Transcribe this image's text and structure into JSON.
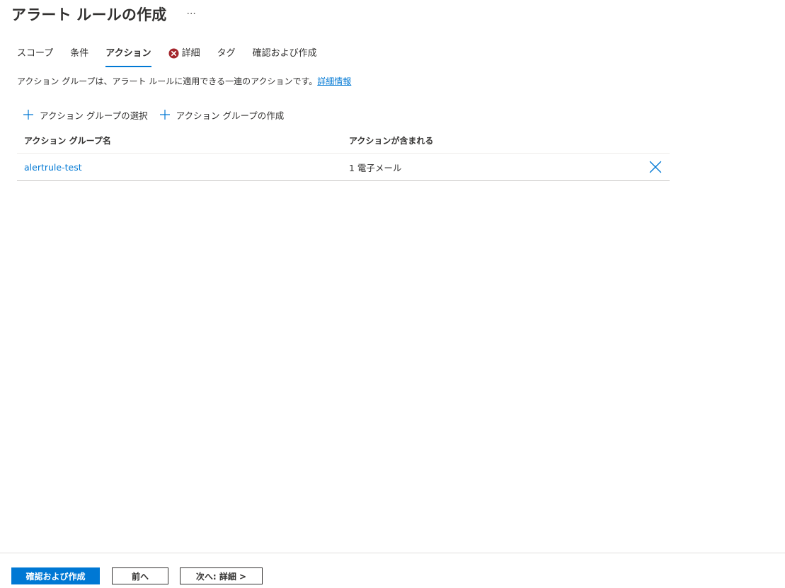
{
  "header": {
    "title": "アラート ルールの作成",
    "more_label": "···"
  },
  "tabs": [
    {
      "label": "スコープ",
      "active": false
    },
    {
      "label": "条件",
      "active": false
    },
    {
      "label": "アクション",
      "active": true
    },
    {
      "label": "詳細",
      "active": false,
      "has_error": true,
      "icon": "error-circle-icon"
    },
    {
      "label": "タグ",
      "active": false
    },
    {
      "label": "確認および作成",
      "active": false
    }
  ],
  "description": {
    "text": "アクション グループは、アラート ルールに適用できる一連のアクションです。",
    "link_label": "詳細情報"
  },
  "commands": {
    "select_label": "アクション グループの選択",
    "create_label": "アクション グループの作成",
    "icon": "plus-icon"
  },
  "table": {
    "columns": [
      "アクション グループ名",
      "アクションが含まれる"
    ],
    "rows": [
      {
        "name": "alertrule-test",
        "actions": "1 電子メール",
        "delete_icon": "close-icon"
      }
    ]
  },
  "footer": {
    "review_create_label": "確認および作成",
    "previous_label": "前へ",
    "next_label": "次へ: 詳細 >"
  },
  "colors": {
    "accent": "#0078d4",
    "error": "#a4262c",
    "text": "#323130"
  }
}
